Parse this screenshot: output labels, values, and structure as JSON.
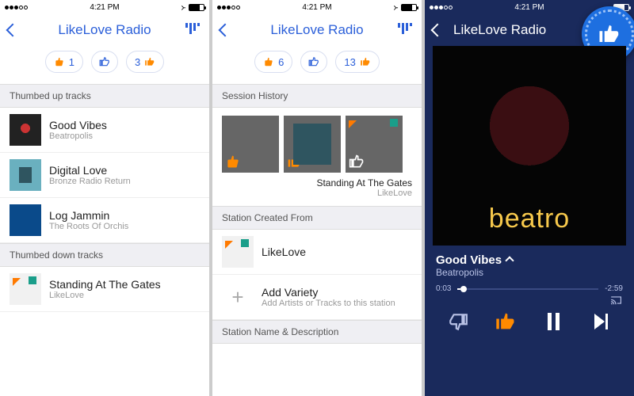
{
  "status": {
    "time": "4:21 PM"
  },
  "app_title": "LikeLove Radio",
  "screen1": {
    "votes": {
      "down": "1",
      "up": "3"
    },
    "section_up": "Thumbed up tracks",
    "section_down": "Thumbed down tracks",
    "up_tracks": [
      {
        "title": "Good Vibes",
        "artist": "Beatropolis"
      },
      {
        "title": "Digital Love",
        "artist": "Bronze Radio Return"
      },
      {
        "title": "Log Jammin",
        "artist": "The Roots Of Orchis"
      }
    ],
    "down_tracks": [
      {
        "title": "Standing At The Gates",
        "artist": "LikeLove"
      }
    ]
  },
  "screen2": {
    "votes": {
      "down": "6",
      "up": "13"
    },
    "section_history": "Session History",
    "history_caption": {
      "title": "Standing At The Gates",
      "artist": "LikeLove"
    },
    "section_created": "Station Created From",
    "created_from": {
      "name": "LikeLove"
    },
    "add_variety": {
      "label": "Add Variety",
      "hint": "Add Artists or Tracks to this station"
    },
    "section_name": "Station Name & Description"
  },
  "screen3": {
    "now": {
      "title": "Good Vibes",
      "artist": "Beatropolis",
      "brand": "beatro"
    },
    "time": {
      "elapsed": "0:03",
      "remaining": "-2:59"
    }
  },
  "colors": {
    "accent_blue": "#2b5fd9",
    "like_orange": "#ff8a00",
    "dark_bg": "#1a2a5c"
  }
}
